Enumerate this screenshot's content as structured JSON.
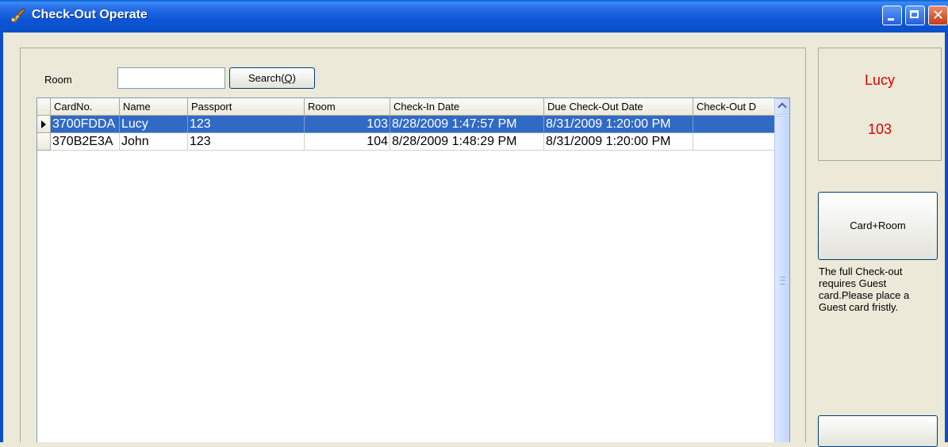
{
  "window": {
    "title": "Check-Out Operate",
    "icon": "broom-icon"
  },
  "search": {
    "room_label": "Room",
    "room_value": "",
    "button_label": "Search(Q)",
    "button_mnemonic": "Q"
  },
  "grid": {
    "columns": [
      "CardNo.",
      "Name",
      "Passport",
      "Room",
      "Check-In Date",
      "Due Check-Out Date",
      "Check-Out D"
    ],
    "rows": [
      {
        "card_no": "3700FDDA",
        "name": "Lucy",
        "passport": "123",
        "room": "103",
        "check_in": "8/28/2009 1:47:57 PM",
        "due_check_out": "8/31/2009 1:20:00 PM",
        "check_out": "",
        "selected": true
      },
      {
        "card_no": "370B2E3A",
        "name": "John",
        "passport": "123",
        "room": "104",
        "check_in": "8/28/2009 1:48:29 PM",
        "due_check_out": "8/31/2009 1:20:00 PM",
        "check_out": "",
        "selected": false
      }
    ]
  },
  "guest_info": {
    "name": "Lucy",
    "room": "103"
  },
  "actions": {
    "card_room_label": "Card+Room",
    "bottom_button_label": ""
  },
  "hint_text": "The full Check-out requires Guest card.Please place a Guest card fristly.",
  "colors": {
    "title_bar": "#0a55d5",
    "selection": "#316ac5",
    "guest_info_text": "#e00000",
    "window_bg": "#ece9d8"
  }
}
